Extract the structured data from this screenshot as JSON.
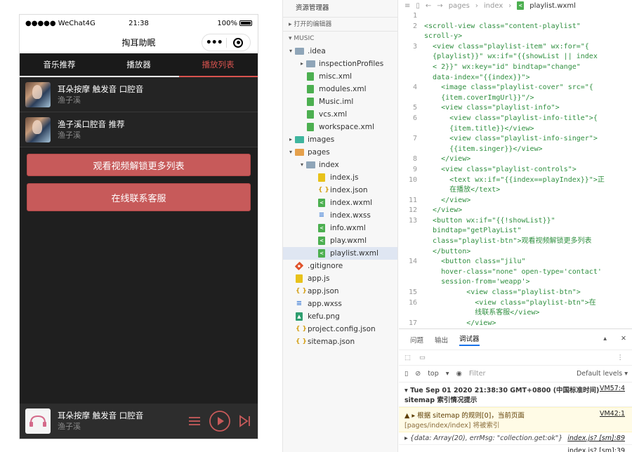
{
  "simulator": {
    "statusbar": {
      "carrier": "●●●●● WeChat4G",
      "time": "21:38",
      "battery": "100%"
    },
    "navbar": {
      "title": "掏耳助眠"
    },
    "tabs": [
      {
        "label": "音乐推荐"
      },
      {
        "label": "播放器"
      },
      {
        "label": "播放列表"
      }
    ],
    "playlist": [
      {
        "title": "耳朵按摩 触发音 口腔音",
        "singer": "渔子溪"
      },
      {
        "title": "渔子溪口腔音 推荐",
        "singer": "渔子溪"
      }
    ],
    "unlock_button": "观看视频解锁更多列表",
    "contact_button": "在线联系客服",
    "player": {
      "title": "耳朵按摩 触发音 口腔音",
      "singer": "渔子溪"
    },
    "accent_color": "#c75a5a"
  },
  "explorer": {
    "header": "资源管理器",
    "open_editors": "打开的编辑器",
    "project": "MUSIC",
    "tree": [
      {
        "name": ".idea",
        "kind": "folder",
        "depth": 0,
        "open": true
      },
      {
        "name": "inspectionProfiles",
        "kind": "folder",
        "depth": 1,
        "open": false
      },
      {
        "name": "misc.xml",
        "kind": "xml",
        "depth": 1
      },
      {
        "name": "modules.xml",
        "kind": "xml",
        "depth": 1
      },
      {
        "name": "Music.iml",
        "kind": "xml",
        "depth": 1
      },
      {
        "name": "vcs.xml",
        "kind": "xml",
        "depth": 1
      },
      {
        "name": "workspace.xml",
        "kind": "xml",
        "depth": 1
      },
      {
        "name": "images",
        "kind": "folder-green",
        "depth": 0,
        "open": false
      },
      {
        "name": "pages",
        "kind": "folder-orange",
        "depth": 0,
        "open": true
      },
      {
        "name": "index",
        "kind": "folder",
        "depth": 1,
        "open": true
      },
      {
        "name": "index.js",
        "kind": "js",
        "depth": 2
      },
      {
        "name": "index.json",
        "kind": "json",
        "depth": 2
      },
      {
        "name": "index.wxml",
        "kind": "wxml",
        "depth": 2
      },
      {
        "name": "index.wxss",
        "kind": "wxss",
        "depth": 2
      },
      {
        "name": "info.wxml",
        "kind": "wxml",
        "depth": 2
      },
      {
        "name": "play.wxml",
        "kind": "wxml",
        "depth": 2
      },
      {
        "name": "playlist.wxml",
        "kind": "wxml",
        "depth": 2,
        "selected": true
      },
      {
        "name": ".gitignore",
        "kind": "git",
        "depth": 0
      },
      {
        "name": "app.js",
        "kind": "js",
        "depth": 0
      },
      {
        "name": "app.json",
        "kind": "json",
        "depth": 0
      },
      {
        "name": "app.wxss",
        "kind": "wxss",
        "depth": 0
      },
      {
        "name": "kefu.png",
        "kind": "png",
        "depth": 0
      },
      {
        "name": "project.config.json",
        "kind": "json",
        "depth": 0
      },
      {
        "name": "sitemap.json",
        "kind": "json",
        "depth": 0
      }
    ]
  },
  "editor": {
    "breadcrumb": [
      "pages",
      "index",
      "playlist.wxml"
    ],
    "lines": [
      {
        "n": "1",
        "code": ""
      },
      {
        "n": "2",
        "code": "<scroll-view class=\"content-playlist\"\nscroll-y>"
      },
      {
        "n": "3",
        "code": "  <view class=\"playlist-item\" wx:for=\"{\n  {playlist}}\" wx:if=\"{{showList || index\n  < 2}}\" wx:key=\"id\" bindtap=\"change\"\n  data-index=\"{{index}}\">"
      },
      {
        "n": "4",
        "code": "    <image class=\"playlist-cover\" src=\"{\n    {item.coverImgUrl}}\"/>"
      },
      {
        "n": "5",
        "code": "    <view class=\"playlist-info\">"
      },
      {
        "n": "6",
        "code": "      <view class=\"playlist-info-title\">{\n      {item.title}}</view>"
      },
      {
        "n": "7",
        "code": "      <view class=\"playlist-info-singer\">\n      {{item.singer}}</view>"
      },
      {
        "n": "8",
        "code": "    </view>"
      },
      {
        "n": "9",
        "code": "    <view class=\"playlist-controls\">"
      },
      {
        "n": "10",
        "code": "      <text wx:if=\"{{index==playIndex}}\">正\n      在播放</text>"
      },
      {
        "n": "11",
        "code": "    </view>"
      },
      {
        "n": "12",
        "code": "  </view>"
      },
      {
        "n": "13",
        "code": "  <button wx:if=\"{{!showList}}\"\n  bindtap=\"getPlayList\"\n  class=\"playlist-btn\">观看视频解锁更多列表\n  </button>"
      },
      {
        "n": "14",
        "code": "    <button class=\"jilu\"\n    hover-class=\"none\" open-type='contact'\n    session-from='weapp'>"
      },
      {
        "n": "15",
        "code": "          <view class=\"playlist-btn\">"
      },
      {
        "n": "16",
        "code": "            <view class=\"playlist-btn\">在\n            线联系客服</view>"
      },
      {
        "n": "17",
        "code": "          </view>"
      }
    ]
  },
  "console": {
    "tabs": [
      "问题",
      "输出",
      "调试器"
    ],
    "active_tab": "调试器",
    "context": "top",
    "filter_placeholder": "Filter",
    "levels": "Default levels ▾",
    "logs": [
      {
        "type": "info",
        "text": "▾ Tue Sep 01 2020 21:38:30 GMT+0800 (中国标准时间)",
        "text2": "sitemap 索引情况提示",
        "src": "VM57:4"
      },
      {
        "type": "warn",
        "text": "▲ ▸ 根据 sitemap 的规则[0]，当前页面",
        "text2": "[pages/index/index] 将被索引",
        "src": "VM42:1"
      },
      {
        "type": "italic",
        "text": "▸ {data: Array(20), errMsg: \"collection.get:ok\"}",
        "src": "index.js? [sm]:89"
      },
      {
        "type": "plain",
        "text": "",
        "src": "index.js? [sm]:39"
      }
    ]
  }
}
